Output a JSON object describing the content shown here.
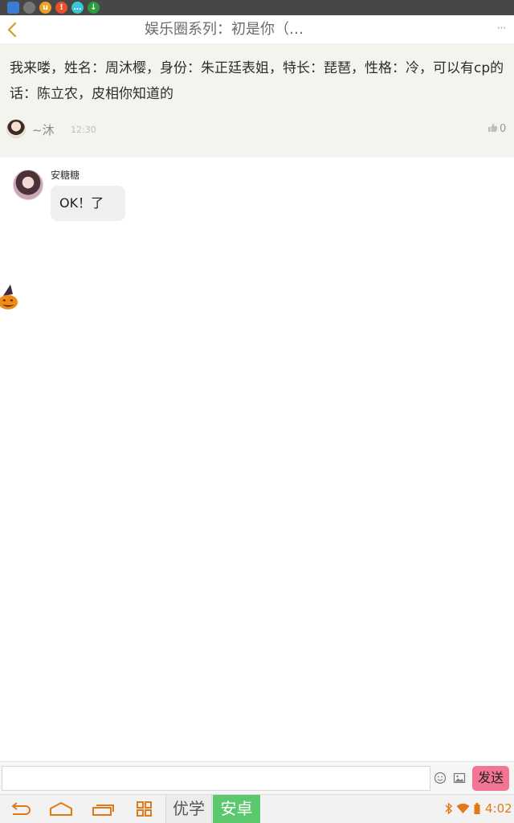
{
  "header": {
    "title": "娱乐圈系列：初是你（…",
    "more_label": "···"
  },
  "post": {
    "text": "我来喽，姓名：周沐樱，身份：朱正廷表姐，特长：琵琶，性格：冷，可以有cp的话：陈立农，皮相你知道的",
    "author": "~沐",
    "time": "12:30",
    "like_count": "0"
  },
  "comments": [
    {
      "author": "安糖糖",
      "text": "OK！了"
    }
  ],
  "input": {
    "placeholder": "",
    "send_label": "发送"
  },
  "ime": {
    "left_label": "优学",
    "right_label": "安卓"
  },
  "status": {
    "time": "4:02"
  },
  "colors": {
    "accent": "#e07a17",
    "send_button": "#f37593",
    "post_background": "#f4f4ef",
    "ime_active": "#5cc86e"
  },
  "icons": {
    "back": "chevron-left-icon",
    "more": "ellipsis-icon",
    "like": "thumb-up-icon",
    "emoji": "smiley-icon",
    "image": "image-icon",
    "decoration": "pumpkin-icon"
  }
}
